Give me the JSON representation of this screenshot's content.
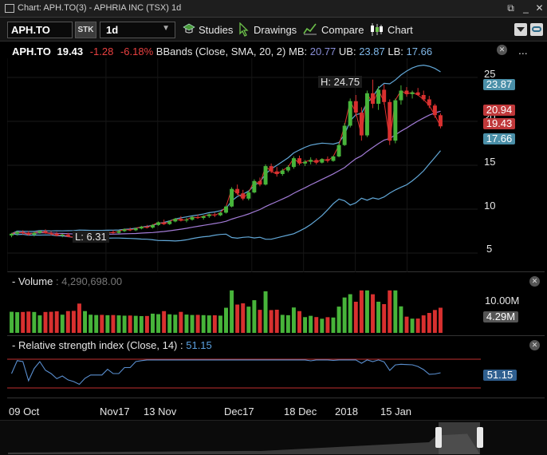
{
  "window": {
    "title": "Chart: APH.TO(3) - APHRIA INC (TSX) 1d",
    "buttons": [
      "popout-icon",
      "minimize-icon",
      "close-icon"
    ]
  },
  "toolbar": {
    "symbol": "APH.TO",
    "sec_type": "STK",
    "interval": "1d",
    "studies_label": "Studies",
    "drawings_label": "Drawings",
    "compare_label": "Compare",
    "chart_label": "Chart"
  },
  "legend": {
    "symbol": "APH.TO",
    "price": "19.43",
    "change": "-1.28",
    "change_pct": "-6.18%",
    "study": "BBands (Close, SMA, 20, 2)",
    "mb_label": "MB:",
    "mb_value": "20.77",
    "ub_label": "UB:",
    "ub_value": "23.87",
    "lb_label": "LB:",
    "lb_value": "17.66",
    "more": "..."
  },
  "main_chart": {
    "high_label": "H: 24.75",
    "low_label": "L: 6.31",
    "y_ticks": [
      "25",
      "20",
      "15",
      "10",
      "5"
    ],
    "tags": {
      "ub": "23.87",
      "mb": "20.94",
      "last": "19.43",
      "lb": "17.66"
    },
    "colors": {
      "up": "#47b43a",
      "down": "#d8302f",
      "price_line": "#e0302f",
      "mid_band": "#a27bd6",
      "bands": "#62a8d8",
      "tag_ub": "#4a8fa8",
      "tag_mb": "#c0383a",
      "tag_last": "#c0383a",
      "tag_lb": "#4a8fa8"
    }
  },
  "volume": {
    "title": "Volume",
    "value": "4,290,698.00",
    "ticks": [
      "10.00M"
    ],
    "tag": "4.29M"
  },
  "rsi": {
    "title": "Relative strength index (Close, 14)",
    "value": "51.15",
    "tag": "51.15"
  },
  "time_axis": [
    "09 Oct",
    "Nov17",
    "13 Nov",
    "Dec17",
    "18 Dec",
    "2018",
    "15 Jan"
  ],
  "chart_data": {
    "type": "candlestick",
    "symbol": "APH.TO",
    "interval": "1d",
    "ylim": [
      3,
      27
    ],
    "ohlc": [
      [
        7.0,
        7.3,
        6.8,
        7.2
      ],
      [
        7.2,
        7.5,
        7.0,
        7.4
      ],
      [
        7.4,
        7.6,
        7.1,
        7.3
      ],
      [
        7.3,
        7.5,
        7.0,
        7.1
      ],
      [
        7.1,
        7.4,
        6.9,
        7.3
      ],
      [
        7.3,
        7.6,
        7.2,
        7.5
      ],
      [
        7.5,
        7.7,
        7.2,
        7.3
      ],
      [
        7.3,
        7.5,
        7.0,
        7.2
      ],
      [
        7.2,
        7.4,
        6.9,
        7.0
      ],
      [
        7.0,
        7.2,
        6.8,
        7.1
      ],
      [
        7.1,
        7.3,
        6.8,
        6.9
      ],
      [
        6.9,
        7.1,
        6.6,
        6.8
      ],
      [
        6.8,
        7.0,
        6.3,
        6.6
      ],
      [
        6.6,
        7.0,
        6.5,
        6.9
      ],
      [
        6.9,
        7.2,
        6.8,
        7.1
      ],
      [
        7.1,
        7.4,
        7.0,
        7.3
      ],
      [
        7.3,
        7.5,
        7.1,
        7.2
      ],
      [
        7.2,
        7.5,
        7.1,
        7.4
      ],
      [
        7.4,
        7.6,
        7.2,
        7.3
      ],
      [
        7.3,
        7.6,
        7.2,
        7.5
      ],
      [
        7.5,
        7.8,
        7.4,
        7.7
      ],
      [
        7.7,
        7.9,
        7.5,
        7.6
      ],
      [
        7.6,
        7.9,
        7.5,
        7.8
      ],
      [
        7.8,
        8.1,
        7.7,
        8.0
      ],
      [
        8.0,
        8.2,
        7.8,
        7.9
      ],
      [
        7.9,
        8.3,
        7.8,
        8.2
      ],
      [
        8.2,
        8.6,
        8.1,
        8.5
      ],
      [
        8.5,
        8.8,
        8.2,
        8.3
      ],
      [
        8.3,
        8.7,
        8.2,
        8.6
      ],
      [
        8.6,
        9.0,
        8.5,
        8.9
      ],
      [
        8.9,
        9.2,
        8.6,
        8.7
      ],
      [
        8.7,
        9.0,
        8.5,
        8.8
      ],
      [
        8.8,
        9.2,
        8.7,
        9.1
      ],
      [
        9.1,
        9.4,
        8.9,
        9.0
      ],
      [
        9.0,
        9.3,
        8.8,
        9.2
      ],
      [
        9.2,
        9.5,
        9.0,
        9.4
      ],
      [
        9.4,
        9.6,
        9.1,
        9.3
      ],
      [
        9.3,
        9.7,
        9.2,
        9.6
      ],
      [
        9.6,
        10.4,
        9.5,
        10.3
      ],
      [
        10.3,
        12.5,
        10.2,
        12.3
      ],
      [
        12.3,
        12.8,
        11.6,
        11.8
      ],
      [
        11.8,
        12.2,
        11.0,
        11.2
      ],
      [
        11.2,
        12.1,
        11.0,
        11.9
      ],
      [
        11.9,
        13.4,
        11.8,
        13.2
      ],
      [
        13.2,
        13.6,
        12.6,
        12.8
      ],
      [
        12.8,
        15.1,
        12.7,
        14.9
      ],
      [
        14.9,
        15.2,
        14.1,
        14.3
      ],
      [
        14.3,
        14.8,
        13.7,
        14.0
      ],
      [
        14.0,
        14.6,
        13.8,
        14.4
      ],
      [
        14.4,
        15.0,
        14.2,
        14.8
      ],
      [
        14.8,
        16.0,
        14.6,
        15.8
      ],
      [
        15.8,
        16.1,
        15.0,
        15.2
      ],
      [
        15.2,
        15.6,
        14.9,
        15.4
      ],
      [
        15.4,
        15.9,
        15.1,
        15.6
      ],
      [
        15.6,
        15.8,
        15.1,
        15.3
      ],
      [
        15.3,
        15.8,
        15.2,
        15.7
      ],
      [
        15.7,
        16.0,
        15.3,
        15.5
      ],
      [
        15.5,
        16.1,
        15.4,
        16.0
      ],
      [
        16.0,
        17.5,
        15.9,
        17.3
      ],
      [
        17.3,
        19.8,
        17.2,
        19.5
      ],
      [
        19.5,
        22.6,
        19.3,
        22.3
      ],
      [
        22.3,
        23.0,
        20.6,
        21.0
      ],
      [
        21.0,
        21.6,
        17.8,
        18.4
      ],
      [
        18.4,
        23.5,
        18.2,
        23.2
      ],
      [
        23.2,
        24.75,
        21.5,
        22.0
      ],
      [
        22.0,
        24.0,
        21.3,
        23.6
      ],
      [
        23.6,
        24.2,
        21.9,
        22.2
      ],
      [
        22.2,
        22.5,
        17.3,
        17.8
      ],
      [
        17.8,
        22.6,
        17.5,
        22.4
      ],
      [
        22.4,
        24.1,
        21.9,
        23.5
      ],
      [
        23.5,
        23.9,
        22.8,
        23.1
      ],
      [
        23.1,
        23.5,
        22.6,
        23.3
      ],
      [
        23.3,
        23.8,
        22.9,
        23.0
      ],
      [
        23.0,
        23.5,
        22.3,
        22.5
      ],
      [
        22.5,
        22.9,
        21.5,
        21.8
      ],
      [
        21.8,
        22.0,
        20.4,
        20.7
      ],
      [
        20.7,
        20.9,
        19.2,
        19.43
      ]
    ],
    "bbands": {
      "mb": 20.77,
      "ub": 23.87,
      "lb": 17.66
    },
    "high": 24.75,
    "low": 6.31,
    "last": 19.43,
    "change": -1.28,
    "change_pct": -6.18,
    "volume_last": 4290698,
    "volume_ylim": [
      0,
      12000000
    ],
    "rsi_last": 51.15,
    "rsi_levels": [
      30,
      70
    ]
  }
}
